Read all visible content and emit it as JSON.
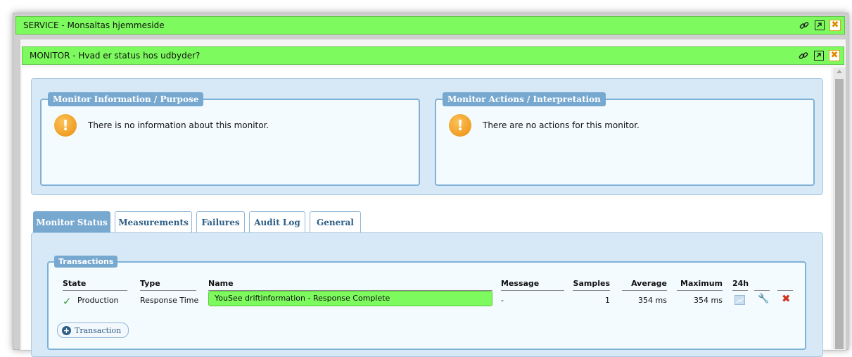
{
  "service": {
    "title": "SERVICE - Monsaltas hjemmeside"
  },
  "monitor": {
    "title": "MONITOR - Hvad er status hos udbyder?"
  },
  "info": {
    "purpose_title": "Monitor Information / Purpose",
    "purpose_message": "There is no information about this monitor.",
    "actions_title": "Monitor Actions / Interpretation",
    "actions_message": "There are no actions for this monitor."
  },
  "tabs": [
    {
      "label": "Monitor Status",
      "active": true
    },
    {
      "label": "Measurements",
      "active": false
    },
    {
      "label": "Failures",
      "active": false
    },
    {
      "label": "Audit Log",
      "active": false
    },
    {
      "label": "General",
      "active": false
    }
  ],
  "transactions": {
    "legend": "Transactions",
    "columns": [
      "State",
      "Type",
      "Name",
      "Message",
      "Samples",
      "Average",
      "Maximum",
      "24h"
    ],
    "rows": [
      {
        "state": "Production",
        "type": "Response Time",
        "name": "YouSee driftinformation - Response Complete",
        "message": "-",
        "samples": "1",
        "average": "354 ms",
        "maximum": "354 ms"
      }
    ],
    "add_label": "Transaction"
  },
  "colors": {
    "titlebar": "#7dfb5e",
    "panel": "#d7e9f6",
    "accent": "#77a8d0"
  }
}
